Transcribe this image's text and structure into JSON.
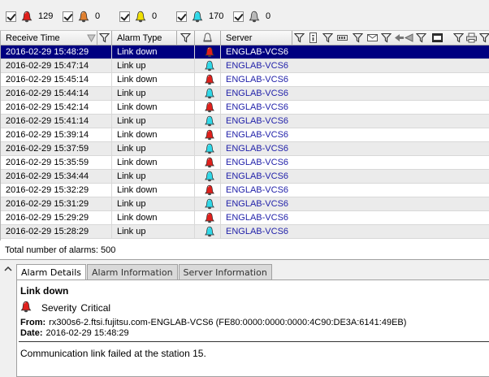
{
  "colors": {
    "critical": "#e0201c",
    "major": "#e08030",
    "minor": "#f0e000",
    "info": "#30d8e8",
    "unknown": "#b8b8b8",
    "selection": "#000080",
    "server_text": "#2222aa"
  },
  "filters": [
    {
      "severity": "critical",
      "icon": "red-alarm-bell-icon",
      "checked": true,
      "count": "129"
    },
    {
      "severity": "major",
      "icon": "orange-alarm-bell-icon",
      "checked": true,
      "count": "0"
    },
    {
      "severity": "minor",
      "icon": "yellow-alarm-bell-icon",
      "checked": true,
      "count": "0"
    },
    {
      "severity": "info",
      "icon": "cyan-alarm-bell-icon",
      "checked": true,
      "count": "170"
    },
    {
      "severity": "unknown",
      "icon": "gray-alarm-bell-icon",
      "checked": true,
      "count": "0"
    }
  ],
  "table": {
    "columns": {
      "receive_time": "Receive Time",
      "alarm_type": "Alarm Type",
      "server": "Server"
    },
    "rows": [
      {
        "time": "2016-02-29 15:48:29",
        "type": "Link down",
        "severity": "critical",
        "server": "ENGLAB-VCS6",
        "selected": true
      },
      {
        "time": "2016-02-29 15:47:14",
        "type": "Link up",
        "severity": "info",
        "server": "ENGLAB-VCS6"
      },
      {
        "time": "2016-02-29 15:45:14",
        "type": "Link down",
        "severity": "critical",
        "server": "ENGLAB-VCS6"
      },
      {
        "time": "2016-02-29 15:44:14",
        "type": "Link up",
        "severity": "info",
        "server": "ENGLAB-VCS6"
      },
      {
        "time": "2016-02-29 15:42:14",
        "type": "Link down",
        "severity": "critical",
        "server": "ENGLAB-VCS6"
      },
      {
        "time": "2016-02-29 15:41:14",
        "type": "Link up",
        "severity": "info",
        "server": "ENGLAB-VCS6"
      },
      {
        "time": "2016-02-29 15:39:14",
        "type": "Link down",
        "severity": "critical",
        "server": "ENGLAB-VCS6"
      },
      {
        "time": "2016-02-29 15:37:59",
        "type": "Link up",
        "severity": "info",
        "server": "ENGLAB-VCS6"
      },
      {
        "time": "2016-02-29 15:35:59",
        "type": "Link down",
        "severity": "critical",
        "server": "ENGLAB-VCS6"
      },
      {
        "time": "2016-02-29 15:34:44",
        "type": "Link up",
        "severity": "info",
        "server": "ENGLAB-VCS6"
      },
      {
        "time": "2016-02-29 15:32:29",
        "type": "Link down",
        "severity": "critical",
        "server": "ENGLAB-VCS6"
      },
      {
        "time": "2016-02-29 15:31:29",
        "type": "Link up",
        "severity": "info",
        "server": "ENGLAB-VCS6"
      },
      {
        "time": "2016-02-29 15:29:29",
        "type": "Link down",
        "severity": "critical",
        "server": "ENGLAB-VCS6"
      },
      {
        "time": "2016-02-29 15:28:29",
        "type": "Link up",
        "severity": "info",
        "server": "ENGLAB-VCS6"
      }
    ]
  },
  "total": {
    "label": "Total number of alarms:",
    "value": "500"
  },
  "details": {
    "tabs": [
      "Alarm Details",
      "Alarm Information",
      "Server Information"
    ],
    "active_tab": 0,
    "title": "Link down",
    "severity_label": "Severity",
    "severity_value": "Critical",
    "from_label": "From:",
    "from_value": "rx300s6-2.ftsi.fujitsu.com-ENGLAB-VCS6 (FE80:0000:0000:0000:4C90:DE3A:6141:49EB)",
    "date_label": "Date:",
    "date_value": "2016-02-29 15:48:29",
    "message": "Communication link failed at the station 15."
  }
}
